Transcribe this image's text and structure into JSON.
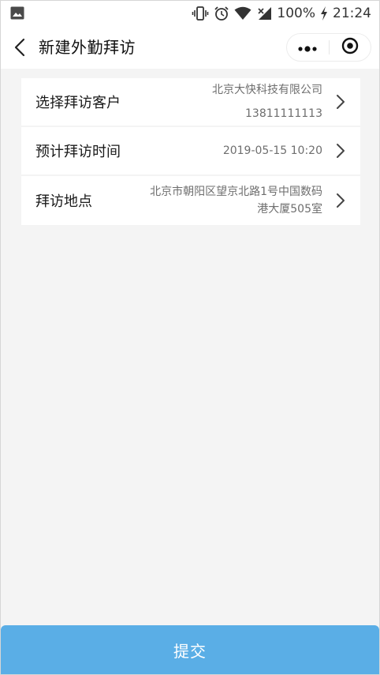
{
  "status_bar": {
    "battery": "100%",
    "time": "21:24",
    "icons": [
      "image-icon",
      "vibrate-icon",
      "alarm-icon",
      "wifi-icon",
      "signal-icon",
      "charging-icon"
    ]
  },
  "header": {
    "title": "新建外勤拜访",
    "back_icon": "chevron-left-icon",
    "more_icon": "more-dots-icon",
    "close_icon": "target-circle-icon"
  },
  "form": {
    "rows": [
      {
        "label": "选择拜访客户",
        "value_line1": "北京大快科技有限公司",
        "value_line2": "13811111113"
      },
      {
        "label": "预计拜访时间",
        "value": "2019-05-15 10:20"
      },
      {
        "label": "拜访地点",
        "value": "北京市朝阳区望京北路1号中国数码港大厦505室"
      }
    ]
  },
  "submit": {
    "label": "提交"
  },
  "colors": {
    "accent": "#5aaee6",
    "background": "#f4f4f4",
    "card": "#ffffff",
    "value_text": "#6e6e6e"
  }
}
